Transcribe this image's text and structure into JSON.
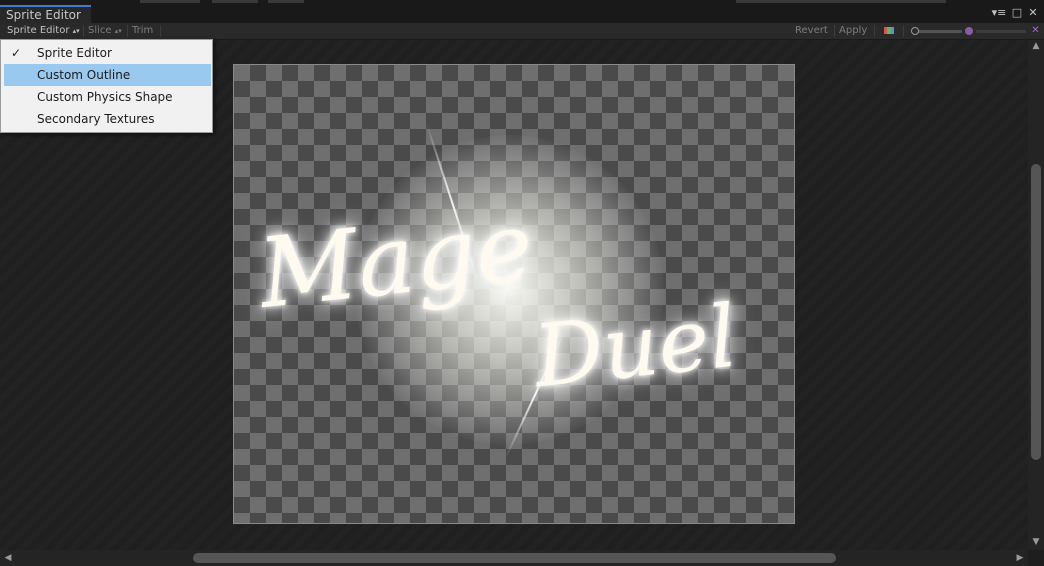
{
  "window": {
    "tab_title": "Sprite Editor"
  },
  "toolbar": {
    "mode_dropdown": "Sprite Editor",
    "slice_label": "Slice",
    "trim_label": "Trim",
    "revert_label": "Revert",
    "apply_label": "Apply"
  },
  "menu": {
    "items": [
      {
        "label": "Sprite Editor",
        "checked": true
      },
      {
        "label": "Custom Outline",
        "highlighted": true
      },
      {
        "label": "Custom Physics Shape"
      },
      {
        "label": "Secondary Textures"
      }
    ]
  },
  "sprite": {
    "logo_line1": "Mage",
    "logo_line2": "Duel"
  },
  "colors": {
    "accent": "#3d7ad0",
    "menu_highlight": "#99c9ef",
    "mip_icon": "#8a5ca8"
  },
  "icons": {
    "dropdown_arrow": "▴▾",
    "check": "✓",
    "window_menu": "▾≡",
    "maximize": "□",
    "close": "✕",
    "alpha_toggle": "✕",
    "arrow_up": "▲",
    "arrow_down": "▼",
    "arrow_left": "◀",
    "arrow_right": "▶"
  }
}
